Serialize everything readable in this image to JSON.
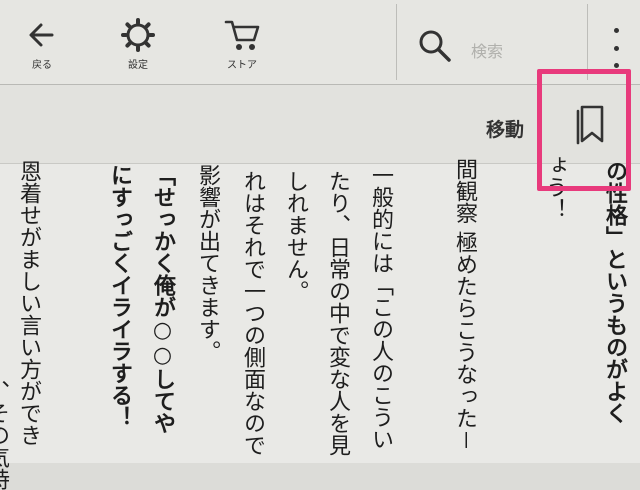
{
  "toolbar": {
    "back_label": "戻る",
    "settings_label": "設定",
    "store_label": "ストア",
    "search_placeholder": "検索"
  },
  "subbar": {
    "move_label": "移動"
  },
  "icons": {
    "back": "arrow-left-icon",
    "settings": "gear-icon",
    "store": "cart-icon",
    "search": "search-icon",
    "menu": "more-vertical-icon",
    "bookmark": "bookmark-icon"
  },
  "colors": {
    "highlight": "#e83a7c"
  },
  "content": {
    "columns": [
      {
        "text": "の性格」というものがよく",
        "bold": true
      },
      {
        "text": "ょう！",
        "bold": false
      },
      {
        "text": "間観察 極めたらこうなった－",
        "bold": false
      },
      {
        "text": "一般的には「この人のこうい",
        "bold": false
      },
      {
        "text": "たり、日常の中で変な人を見",
        "bold": false
      },
      {
        "text": "しれません。",
        "bold": false
      },
      {
        "text": "れはそれで一つの側面なので",
        "bold": false
      },
      {
        "text": "影響が出てきます。",
        "bold": false
      },
      {
        "text": "「せっかく俺が○○してや",
        "bold": true
      },
      {
        "text": "にすっごくイライラする！",
        "bold": true
      },
      {
        "text": "恩着せがましい言い方ができ",
        "bold": false
      },
      {
        "text": "、その気持",
        "bold": false
      }
    ]
  }
}
